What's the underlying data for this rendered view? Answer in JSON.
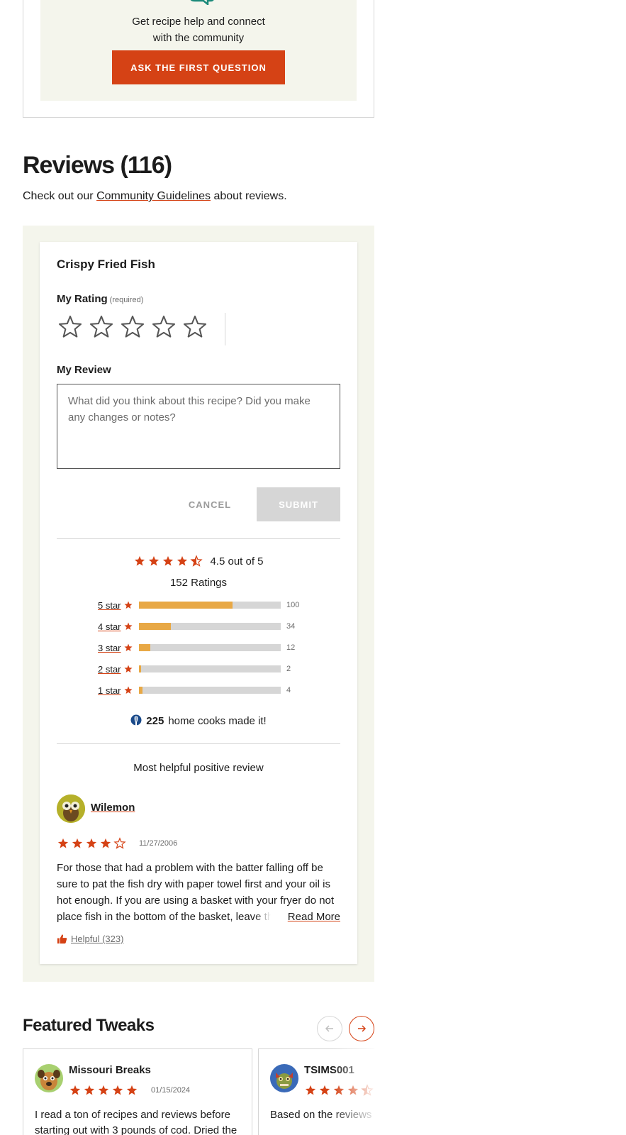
{
  "qa": {
    "prompt": "Get recipe help and connect with the community",
    "button_label": "ASK THE FIRST QUESTION"
  },
  "reviews": {
    "title": "Reviews (116)",
    "sub_before": "Check out our",
    "sub_link": "Community Guidelines",
    "sub_after": "about reviews."
  },
  "review_form": {
    "recipe_name": "Crispy Fried Fish",
    "rating_label": "My Rating",
    "rating_required": "(required)",
    "review_label": "My Review",
    "review_placeholder": "What did you think about this recipe? Did you make any changes or notes?",
    "cancel_label": "CANCEL",
    "submit_label": "SUBMIT"
  },
  "rating_summary": {
    "average": 4.5,
    "average_text": "4.5 out of 5",
    "ratings_count_text": "152 Ratings",
    "bars": [
      {
        "label": "5 star",
        "count": 100
      },
      {
        "label": "4 star",
        "count": 34
      },
      {
        "label": "3 star",
        "count": 12
      },
      {
        "label": "2 star",
        "count": 2
      },
      {
        "label": "1 star",
        "count": 4
      }
    ],
    "made_it_count": "225",
    "made_it_text": "home cooks made it!"
  },
  "top_review": {
    "heading": "Most helpful positive review",
    "author": "Wilemon",
    "rating": 4,
    "date": "11/27/2006",
    "body": "For those that had a problem with the batter falling off be sure to pat the fish dry with paper towel first and your oil is hot enough. If you are using a basket with your fryer do not place fish in the bottom of the basket, leave the basket",
    "read_more": "Read More",
    "helpful": "Helpful (323)"
  },
  "featured_tweaks": {
    "title": "Featured Tweaks",
    "items": [
      {
        "author": "Missouri Breaks",
        "rating": 5,
        "date": "01/15/2024",
        "text": "I read a ton of recipes and reviews before starting out with 3 pounds of cod. Dried the"
      },
      {
        "author": "TSIMS001",
        "rating": 4.5,
        "date": "",
        "text": "Based on the reviews decided to double all"
      }
    ]
  },
  "colors": {
    "accent": "#d54215",
    "bar_fill": "#e8a845",
    "panel_bg": "#f4f5ec",
    "made_it_icon": "#1a4a8a",
    "teal_icon": "#1c8a7a"
  }
}
